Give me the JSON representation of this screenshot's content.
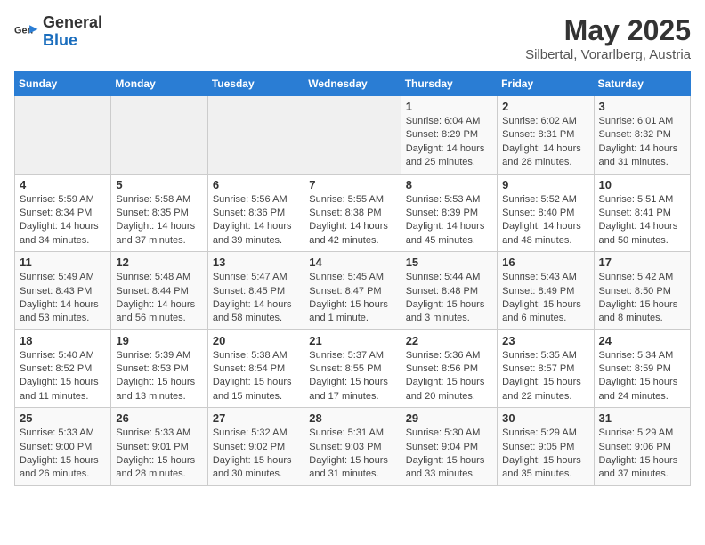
{
  "header": {
    "logo_general": "General",
    "logo_blue": "Blue",
    "month_year": "May 2025",
    "location": "Silbertal, Vorarlberg, Austria"
  },
  "days_of_week": [
    "Sunday",
    "Monday",
    "Tuesday",
    "Wednesday",
    "Thursday",
    "Friday",
    "Saturday"
  ],
  "weeks": [
    [
      {
        "day": "",
        "info": ""
      },
      {
        "day": "",
        "info": ""
      },
      {
        "day": "",
        "info": ""
      },
      {
        "day": "",
        "info": ""
      },
      {
        "day": "1",
        "info": "Sunrise: 6:04 AM\nSunset: 8:29 PM\nDaylight: 14 hours\nand 25 minutes."
      },
      {
        "day": "2",
        "info": "Sunrise: 6:02 AM\nSunset: 8:31 PM\nDaylight: 14 hours\nand 28 minutes."
      },
      {
        "day": "3",
        "info": "Sunrise: 6:01 AM\nSunset: 8:32 PM\nDaylight: 14 hours\nand 31 minutes."
      }
    ],
    [
      {
        "day": "4",
        "info": "Sunrise: 5:59 AM\nSunset: 8:34 PM\nDaylight: 14 hours\nand 34 minutes."
      },
      {
        "day": "5",
        "info": "Sunrise: 5:58 AM\nSunset: 8:35 PM\nDaylight: 14 hours\nand 37 minutes."
      },
      {
        "day": "6",
        "info": "Sunrise: 5:56 AM\nSunset: 8:36 PM\nDaylight: 14 hours\nand 39 minutes."
      },
      {
        "day": "7",
        "info": "Sunrise: 5:55 AM\nSunset: 8:38 PM\nDaylight: 14 hours\nand 42 minutes."
      },
      {
        "day": "8",
        "info": "Sunrise: 5:53 AM\nSunset: 8:39 PM\nDaylight: 14 hours\nand 45 minutes."
      },
      {
        "day": "9",
        "info": "Sunrise: 5:52 AM\nSunset: 8:40 PM\nDaylight: 14 hours\nand 48 minutes."
      },
      {
        "day": "10",
        "info": "Sunrise: 5:51 AM\nSunset: 8:41 PM\nDaylight: 14 hours\nand 50 minutes."
      }
    ],
    [
      {
        "day": "11",
        "info": "Sunrise: 5:49 AM\nSunset: 8:43 PM\nDaylight: 14 hours\nand 53 minutes."
      },
      {
        "day": "12",
        "info": "Sunrise: 5:48 AM\nSunset: 8:44 PM\nDaylight: 14 hours\nand 56 minutes."
      },
      {
        "day": "13",
        "info": "Sunrise: 5:47 AM\nSunset: 8:45 PM\nDaylight: 14 hours\nand 58 minutes."
      },
      {
        "day": "14",
        "info": "Sunrise: 5:45 AM\nSunset: 8:47 PM\nDaylight: 15 hours\nand 1 minute."
      },
      {
        "day": "15",
        "info": "Sunrise: 5:44 AM\nSunset: 8:48 PM\nDaylight: 15 hours\nand 3 minutes."
      },
      {
        "day": "16",
        "info": "Sunrise: 5:43 AM\nSunset: 8:49 PM\nDaylight: 15 hours\nand 6 minutes."
      },
      {
        "day": "17",
        "info": "Sunrise: 5:42 AM\nSunset: 8:50 PM\nDaylight: 15 hours\nand 8 minutes."
      }
    ],
    [
      {
        "day": "18",
        "info": "Sunrise: 5:40 AM\nSunset: 8:52 PM\nDaylight: 15 hours\nand 11 minutes."
      },
      {
        "day": "19",
        "info": "Sunrise: 5:39 AM\nSunset: 8:53 PM\nDaylight: 15 hours\nand 13 minutes."
      },
      {
        "day": "20",
        "info": "Sunrise: 5:38 AM\nSunset: 8:54 PM\nDaylight: 15 hours\nand 15 minutes."
      },
      {
        "day": "21",
        "info": "Sunrise: 5:37 AM\nSunset: 8:55 PM\nDaylight: 15 hours\nand 17 minutes."
      },
      {
        "day": "22",
        "info": "Sunrise: 5:36 AM\nSunset: 8:56 PM\nDaylight: 15 hours\nand 20 minutes."
      },
      {
        "day": "23",
        "info": "Sunrise: 5:35 AM\nSunset: 8:57 PM\nDaylight: 15 hours\nand 22 minutes."
      },
      {
        "day": "24",
        "info": "Sunrise: 5:34 AM\nSunset: 8:59 PM\nDaylight: 15 hours\nand 24 minutes."
      }
    ],
    [
      {
        "day": "25",
        "info": "Sunrise: 5:33 AM\nSunset: 9:00 PM\nDaylight: 15 hours\nand 26 minutes."
      },
      {
        "day": "26",
        "info": "Sunrise: 5:33 AM\nSunset: 9:01 PM\nDaylight: 15 hours\nand 28 minutes."
      },
      {
        "day": "27",
        "info": "Sunrise: 5:32 AM\nSunset: 9:02 PM\nDaylight: 15 hours\nand 30 minutes."
      },
      {
        "day": "28",
        "info": "Sunrise: 5:31 AM\nSunset: 9:03 PM\nDaylight: 15 hours\nand 31 minutes."
      },
      {
        "day": "29",
        "info": "Sunrise: 5:30 AM\nSunset: 9:04 PM\nDaylight: 15 hours\nand 33 minutes."
      },
      {
        "day": "30",
        "info": "Sunrise: 5:29 AM\nSunset: 9:05 PM\nDaylight: 15 hours\nand 35 minutes."
      },
      {
        "day": "31",
        "info": "Sunrise: 5:29 AM\nSunset: 9:06 PM\nDaylight: 15 hours\nand 37 minutes."
      }
    ]
  ]
}
